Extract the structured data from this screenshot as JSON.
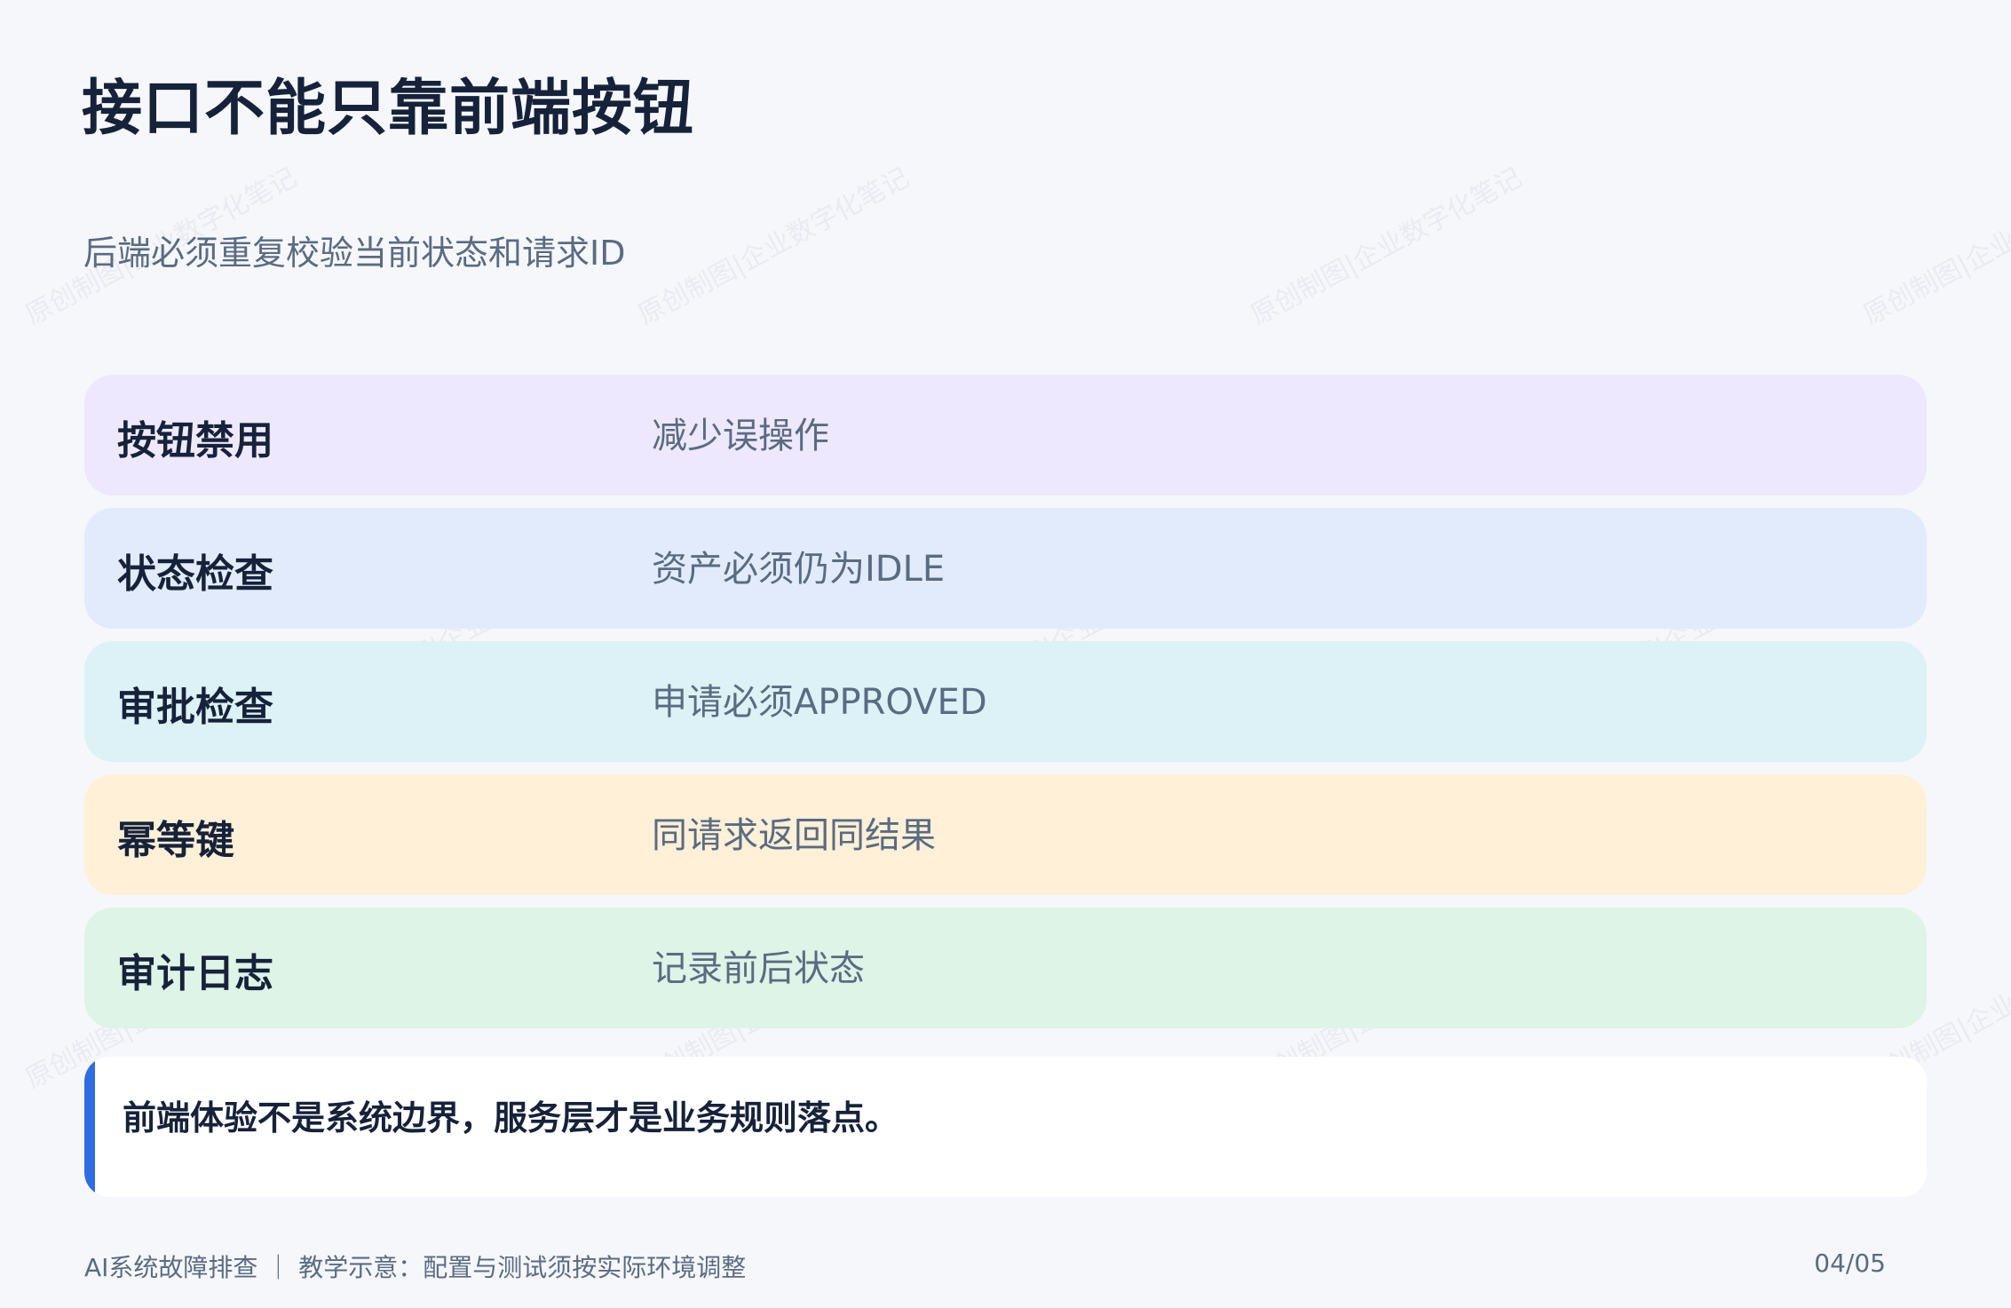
{
  "page": {
    "title": "接口不能只靠前端按钮",
    "subtitle": "后端必须重复校验当前状态和请求ID"
  },
  "rows": [
    {
      "label": "按钮禁用",
      "desc": "减少误操作",
      "bg": "#ede8fd"
    },
    {
      "label": "状态检查",
      "desc": "资产必须仍为IDLE",
      "bg": "#e1ebfc"
    },
    {
      "label": "审批检查",
      "desc": "申请必须APPROVED",
      "bg": "#dcf2f6"
    },
    {
      "label": "幂等键",
      "desc": "同请求返回同结果",
      "bg": "#fff0d7"
    },
    {
      "label": "审计日志",
      "desc": "记录前后状态",
      "bg": "#ddf4e6"
    }
  ],
  "callout": {
    "text": "前端体验不是系统边界，服务层才是业务规则落点。",
    "accent": "#2f6be3"
  },
  "footer": {
    "left": "AI系统故障排查 ｜ 教学示意：配置与测试须按实际环境调整",
    "page_number": "04/05"
  },
  "watermark": {
    "text": "原创制图|企业数字化笔记"
  }
}
